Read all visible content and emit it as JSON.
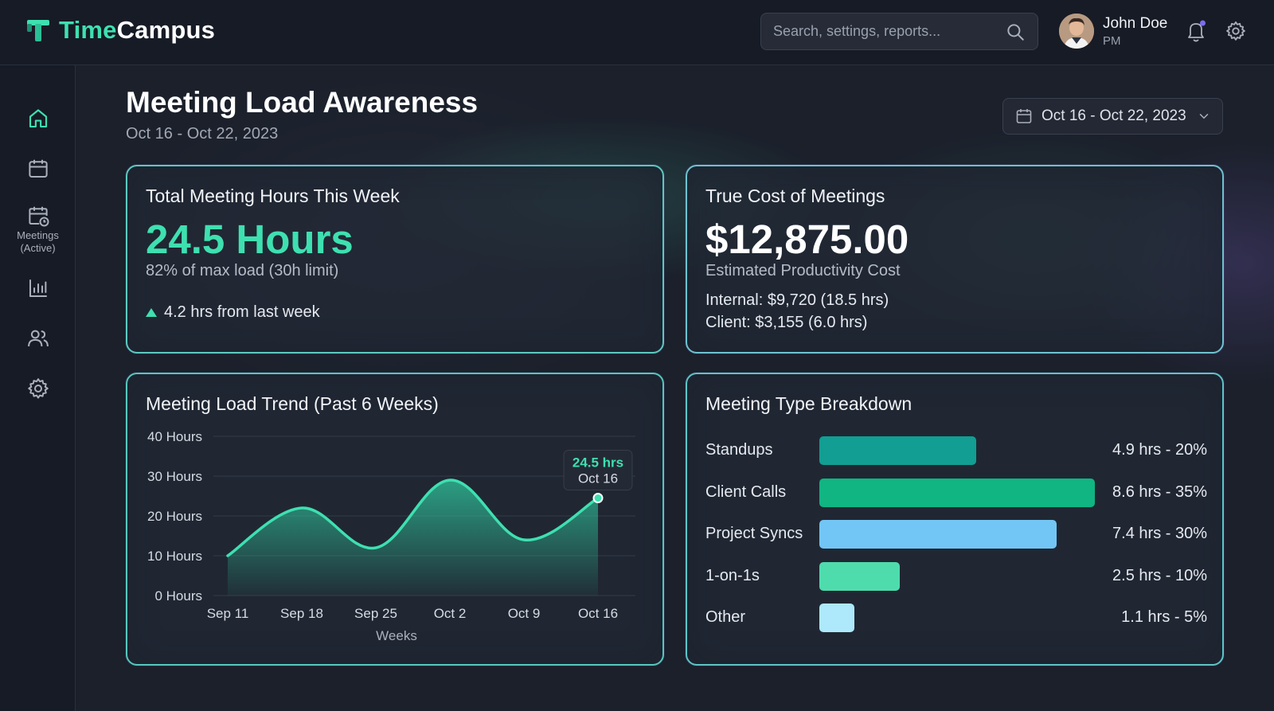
{
  "app": {
    "logo_part1": "Time",
    "logo_part2": "Campus"
  },
  "search": {
    "placeholder": "Search, settings, reports..."
  },
  "user": {
    "name": "John Doe",
    "role": "PM"
  },
  "sidebar": {
    "items": [
      {
        "icon": "home-icon"
      },
      {
        "icon": "calendar-icon"
      },
      {
        "icon": "calendar-clock-icon",
        "label": "Meetings (Active)"
      },
      {
        "icon": "bar-chart-icon"
      },
      {
        "icon": "users-icon"
      },
      {
        "icon": "gear-icon"
      }
    ]
  },
  "page": {
    "title": "Meeting Load Awareness",
    "subtitle": "Oct 16 - Oct 22, 2023",
    "date_range": "Oct 16 - Oct 22, 2023"
  },
  "hours_card": {
    "title": "Total Meeting Hours This Week",
    "value": "24.5 Hours",
    "load": "82% of max load (30h limit)",
    "delta": "4.2 hrs from last week"
  },
  "cost_card": {
    "title": "True Cost of Meetings",
    "value": "$12,875.00",
    "subtitle": "Estimated Productivity Cost",
    "internal": "Internal: $9,720 (18.5 hrs)",
    "client": "Client: $3,155 (6.0 hrs)"
  },
  "trend_card": {
    "title": "Meeting Load Trend (Past 6 Weeks)",
    "tooltip_value": "24.5 hrs",
    "tooltip_label": "Oct 16"
  },
  "chart_data": {
    "type": "area",
    "title": "Meeting Load Trend (Past 6 Weeks)",
    "xlabel": "Weeks",
    "ylabel": "",
    "categories": [
      "Sep 11",
      "Sep 18",
      "Sep 25",
      "Oct 2",
      "Oct 9",
      "Oct 16"
    ],
    "values": [
      10,
      22,
      12,
      29,
      14,
      24.5
    ],
    "y_ticks": [
      "0 Hours",
      "10 Hours",
      "20 Hours",
      "30 Hours",
      "40 Hours"
    ],
    "ylim": [
      0,
      40
    ],
    "grid": true,
    "color": "#3ee0b0"
  },
  "breakdown_card": {
    "title": "Meeting Type Breakdown",
    "rows": [
      {
        "label": "Standups",
        "value": "4.9 hrs - 20%",
        "hours": 4.9,
        "color": "#129e92"
      },
      {
        "label": "Client Calls",
        "value": "8.6 hrs - 35%",
        "hours": 8.6,
        "color": "#10b582"
      },
      {
        "label": "Project Syncs",
        "value": "7.4 hrs - 30%",
        "hours": 7.4,
        "color": "#72c6f5"
      },
      {
        "label": "1-on-1s",
        "value": "2.5 hrs - 10%",
        "hours": 2.5,
        "color": "#4fdcad"
      },
      {
        "label": "Other",
        "value": "1.1 hrs - 5%",
        "hours": 1.1,
        "color": "#aee8fb"
      }
    ]
  }
}
